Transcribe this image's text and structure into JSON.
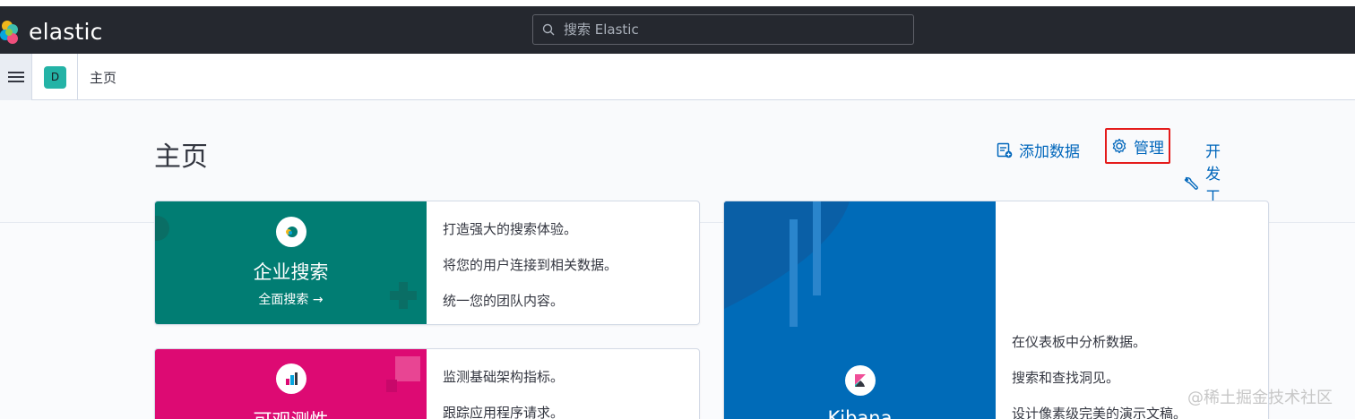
{
  "brand": {
    "name": "elastic"
  },
  "search": {
    "placeholder": "搜索 Elastic"
  },
  "space": {
    "initial": "D"
  },
  "breadcrumb": {
    "current": "主页"
  },
  "page": {
    "title": "主页"
  },
  "header_links": {
    "add_data": "添加数据",
    "manage": "管理",
    "dev_tools": "开发工具"
  },
  "solutions": {
    "enterprise_search": {
      "title": "企业搜索",
      "link": "全面搜索 →",
      "features": [
        "打造强大的搜索体验。",
        "将您的用户连接到相关数据。",
        "统一您的团队内容。"
      ],
      "color": "#017d73"
    },
    "observability": {
      "title": "可观测性",
      "features": [
        "监测基础架构指标。",
        "跟踪应用程序请求。"
      ],
      "color": "#dd0a73"
    },
    "kibana": {
      "title": "Kibana",
      "features": [
        "在仪表板中分析数据。",
        "搜索和查找洞见。",
        "设计像素级完美的演示文稿。"
      ],
      "color": "#006bb8"
    }
  },
  "watermark": "@稀土掘金技术社区"
}
